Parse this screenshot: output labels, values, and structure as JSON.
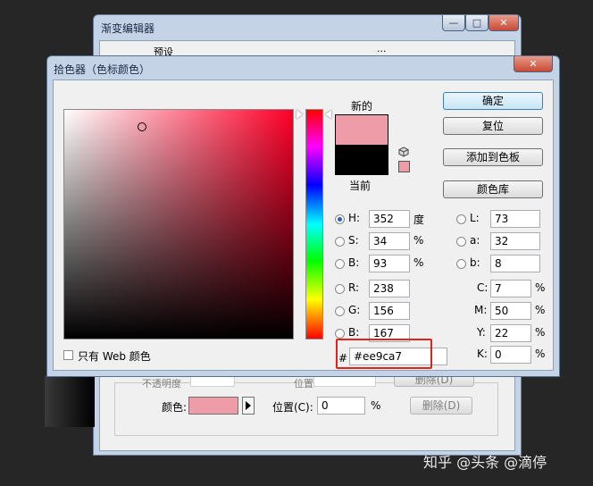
{
  "gradient_editor": {
    "title": "渐变编辑器",
    "preset_partial": "预设",
    "color_label": "颜色:",
    "color_value": "#ee9ca7",
    "position_label": "位置(C):",
    "position_value": "0",
    "percent": "%",
    "delete_label": "删除(D)",
    "opacity_partial": "不透明度",
    "location_partial": "位置",
    "dots": "..."
  },
  "picker": {
    "title": "拾色器（色标颜色）",
    "new_label": "新的",
    "current_label": "当前",
    "new_color": "#ee9ca7",
    "current_color": "#000000",
    "web_small_color": "#ee9ca7",
    "buttons": {
      "ok": "确定",
      "reset": "复位",
      "add_swatch": "添加到色板",
      "color_library": "颜色库"
    },
    "hsb": [
      {
        "label": "H:",
        "value": "352",
        "unit": "度",
        "selected": true
      },
      {
        "label": "S:",
        "value": "34",
        "unit": "%",
        "selected": false
      },
      {
        "label": "B:",
        "value": "93",
        "unit": "%",
        "selected": false
      }
    ],
    "rgb": [
      {
        "label": "R:",
        "value": "238"
      },
      {
        "label": "G:",
        "value": "156"
      },
      {
        "label": "B:",
        "value": "167"
      }
    ],
    "lab": [
      {
        "label": "L:",
        "value": "73"
      },
      {
        "label": "a:",
        "value": "32"
      },
      {
        "label": "b:",
        "value": "8"
      }
    ],
    "cmyk": [
      {
        "label": "C:",
        "value": "7",
        "unit": "%"
      },
      {
        "label": "M:",
        "value": "50",
        "unit": "%"
      },
      {
        "label": "Y:",
        "value": "22",
        "unit": "%"
      },
      {
        "label": "K:",
        "value": "0",
        "unit": "%"
      }
    ],
    "hex_prefix": "#",
    "hex_value": "#ee9ca7",
    "web_only_label": "只有 Web 颜色",
    "hue_accent": "#ff0028",
    "highlight_color": "#e2231a"
  },
  "window_controls": {
    "minimize": "—",
    "maximize": "□",
    "close": "✕"
  },
  "watermark": "知乎 @头条 @滴停"
}
